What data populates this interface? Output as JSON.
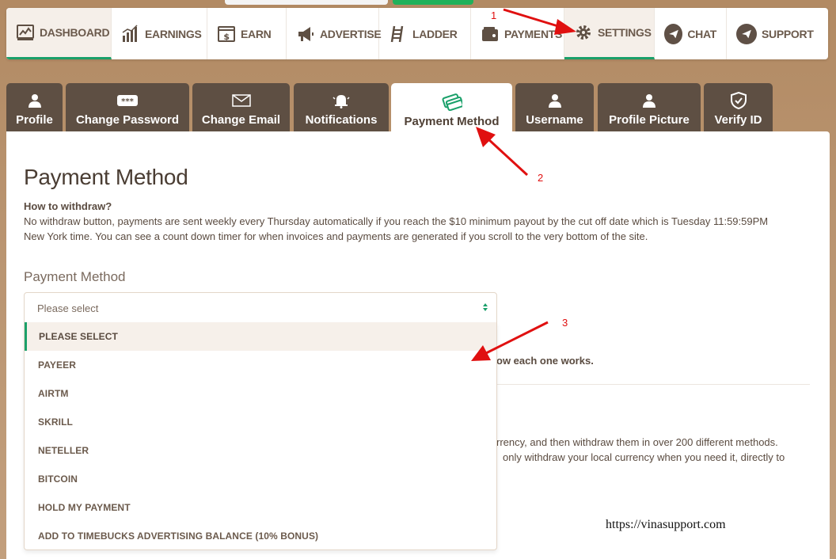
{
  "topnav": {
    "items": [
      {
        "label": "DASHBOARD",
        "icon": "dashboard-icon",
        "active": true
      },
      {
        "label": "EARNINGS",
        "icon": "earnings-chart-icon"
      },
      {
        "label": "EARN",
        "icon": "earn-dollar-icon"
      },
      {
        "label": "ADVERTISE",
        "icon": "megaphone-icon"
      },
      {
        "label": "LADDER",
        "icon": "ladder-icon"
      },
      {
        "label": "PAYMENTS",
        "icon": "wallet-icon"
      },
      {
        "label": "SETTINGS",
        "icon": "gear-icon",
        "active": true
      },
      {
        "label": "CHAT",
        "icon": "paper-plane-icon"
      },
      {
        "label": "SUPPORT",
        "icon": "paper-plane-icon"
      }
    ]
  },
  "tabs": [
    {
      "label": "Profile",
      "icon": "user-icon"
    },
    {
      "label": "Change Password",
      "icon": "password-icon"
    },
    {
      "label": "Change Email",
      "icon": "envelope-icon"
    },
    {
      "label": "Notifications",
      "icon": "bell-icon"
    },
    {
      "label": "Payment Method",
      "icon": "credit-cards-icon",
      "active": true
    },
    {
      "label": "Username",
      "icon": "user-icon"
    },
    {
      "label": "Profile Picture",
      "icon": "user-icon"
    },
    {
      "label": "Verify ID",
      "icon": "shield-check-icon"
    }
  ],
  "main": {
    "title": "Payment Method",
    "howto_title": "How to withdraw?",
    "howto_line1": "No withdraw button, payments are sent weekly every Thursday automatically if you reach the $10 minimum payout by the cut off date which is Tuesday 11:59:59PM",
    "howto_line2": "New York time. You can see a count down timer for when invoices and payments are generated if you scroll to the very bottom of the site.",
    "select_label": "Payment Method",
    "select_value": "Please select",
    "options": [
      "PLEASE SELECT",
      "PAYEER",
      "AIRTM",
      "SKRILL",
      "NETELLER",
      "BITCOIN",
      "HOLD MY PAYMENT",
      "ADD TO TIMEBUCKS ADVERTISING BALANCE (10% BONUS)"
    ],
    "behind_text_1": "ow each one works.",
    "behind_text_2": "rrency, and then withdraw them in over 200 different methods.",
    "behind_text_3": "only withdraw your local currency when you need it, directly to"
  },
  "annotations": {
    "n1": "1",
    "n2": "2",
    "n3": "3",
    "color": "#e01010"
  },
  "watermark": "https://vinasupport.com",
  "colors": {
    "accent": "#1aa06a",
    "tab_bg": "#5e4f43",
    "text": "#5a4b40"
  }
}
